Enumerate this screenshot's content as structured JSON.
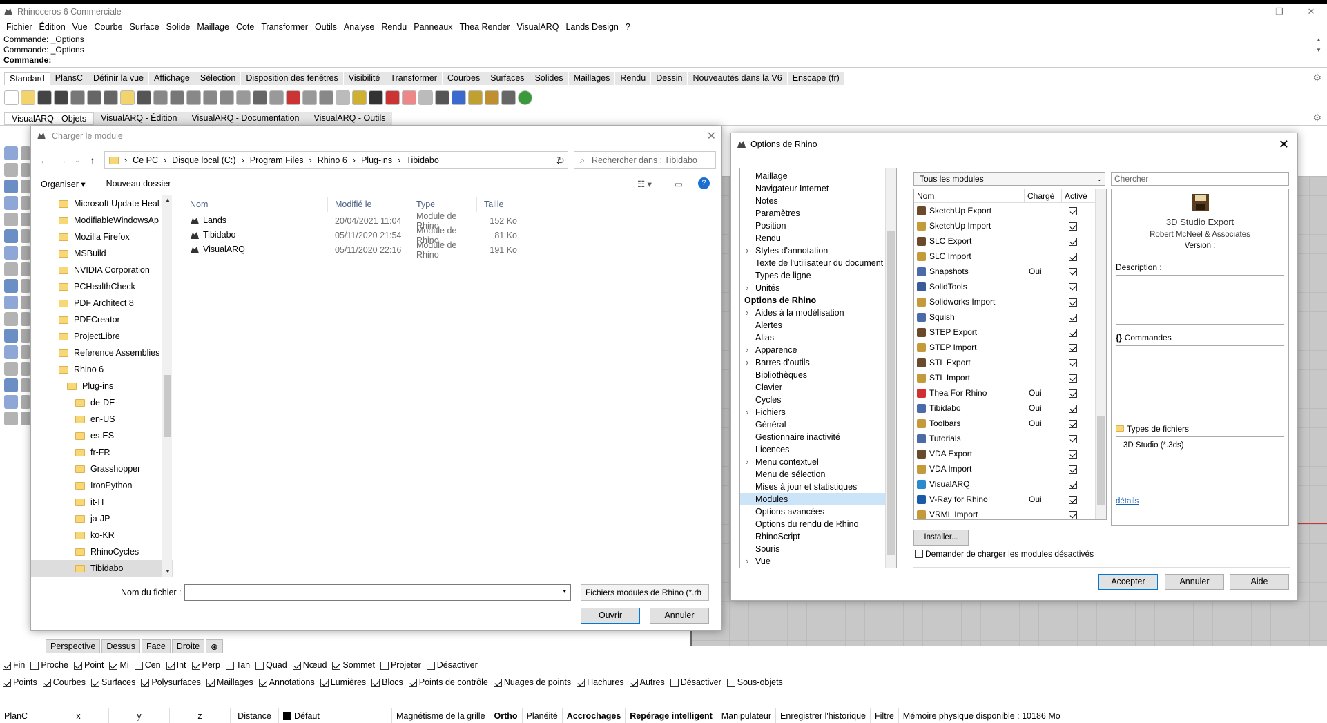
{
  "app": {
    "title": "Rhinoceros 6 Commerciale",
    "menu": [
      "Fichier",
      "Édition",
      "Vue",
      "Courbe",
      "Surface",
      "Solide",
      "Maillage",
      "Cote",
      "Transformer",
      "Outils",
      "Analyse",
      "Rendu",
      "Panneaux",
      "Thea Render",
      "VisualARQ",
      "Lands Design",
      "?"
    ],
    "command_lines": [
      "Commande: _Options",
      "Commande: _Options"
    ],
    "command_prompt": "Commande:",
    "toolbar_tabs": [
      "Standard",
      "PlansC",
      "Définir la vue",
      "Affichage",
      "Sélection",
      "Disposition des fenêtres",
      "Visibilité",
      "Transformer",
      "Courbes",
      "Surfaces",
      "Solides",
      "Maillages",
      "Rendu",
      "Dessin",
      "Nouveautés dans la V6",
      "Enscape (fr)"
    ],
    "visualarq_tabs": [
      "VisualARQ - Objets",
      "VisualARQ - Édition",
      "VisualARQ - Documentation",
      "VisualARQ - Outils"
    ],
    "viewport_tabs": [
      "Perspective",
      "Dessus",
      "Face",
      "Droite"
    ],
    "snap_row": [
      {
        "label": "Fin",
        "on": true
      },
      {
        "label": "Proche",
        "on": false
      },
      {
        "label": "Point",
        "on": true
      },
      {
        "label": "Mi",
        "on": true
      },
      {
        "label": "Cen",
        "on": false
      },
      {
        "label": "Int",
        "on": true
      },
      {
        "label": "Perp",
        "on": true
      },
      {
        "label": "Tan",
        "on": false
      },
      {
        "label": "Quad",
        "on": false
      },
      {
        "label": "Nœud",
        "on": true
      },
      {
        "label": "Sommet",
        "on": true
      },
      {
        "label": "Projeter",
        "on": false
      },
      {
        "label": "Désactiver",
        "on": false
      }
    ],
    "filter_row": [
      {
        "label": "Points",
        "on": true
      },
      {
        "label": "Courbes",
        "on": true
      },
      {
        "label": "Surfaces",
        "on": true
      },
      {
        "label": "Polysurfaces",
        "on": true
      },
      {
        "label": "Maillages",
        "on": true
      },
      {
        "label": "Annotations",
        "on": true
      },
      {
        "label": "Lumières",
        "on": true
      },
      {
        "label": "Blocs",
        "on": true
      },
      {
        "label": "Points de contrôle",
        "on": true
      },
      {
        "label": "Nuages de points",
        "on": true
      },
      {
        "label": "Hachures",
        "on": true
      },
      {
        "label": "Autres",
        "on": true
      },
      {
        "label": "Désactiver",
        "on": false
      },
      {
        "label": "Sous-objets",
        "on": false
      }
    ],
    "status": {
      "plane": "PlanC",
      "x": "x",
      "y": "y",
      "z": "z",
      "distance": "Distance",
      "layer": "Défaut",
      "grid_snap": "Magnétisme de la grille",
      "ortho": "Ortho",
      "planar": "Planéité",
      "osnap": "Accrochages",
      "smarttrack": "Repérage intelligent",
      "gumball": "Manipulateur",
      "history": "Enregistrer l'historique",
      "filter": "Filtre",
      "memory": "Mémoire physique disponible : 10186 Mo"
    }
  },
  "file_dialog": {
    "title": "Charger le module",
    "breadcrumb": [
      "Ce PC",
      "Disque local (C:)",
      "Program Files",
      "Rhino 6",
      "Plug-ins",
      "Tibidabo"
    ],
    "search_placeholder": "Rechercher dans : Tibidabo",
    "organize": "Organiser",
    "new_folder": "Nouveau dossier",
    "tree": [
      {
        "label": "Microsoft Update Heal",
        "indent": 0
      },
      {
        "label": "ModifiableWindowsAp",
        "indent": 0
      },
      {
        "label": "Mozilla Firefox",
        "indent": 0
      },
      {
        "label": "MSBuild",
        "indent": 0
      },
      {
        "label": "NVIDIA Corporation",
        "indent": 0
      },
      {
        "label": "PCHealthCheck",
        "indent": 0
      },
      {
        "label": "PDF Architect 8",
        "indent": 0
      },
      {
        "label": "PDFCreator",
        "indent": 0
      },
      {
        "label": "ProjectLibre",
        "indent": 0
      },
      {
        "label": "Reference Assemblies",
        "indent": 0
      },
      {
        "label": "Rhino 6",
        "indent": 0
      },
      {
        "label": "Plug-ins",
        "indent": 1
      },
      {
        "label": "de-DE",
        "indent": 2
      },
      {
        "label": "en-US",
        "indent": 2
      },
      {
        "label": "es-ES",
        "indent": 2
      },
      {
        "label": "fr-FR",
        "indent": 2
      },
      {
        "label": "Grasshopper",
        "indent": 2
      },
      {
        "label": "IronPython",
        "indent": 2
      },
      {
        "label": "it-IT",
        "indent": 2
      },
      {
        "label": "ja-JP",
        "indent": 2
      },
      {
        "label": "ko-KR",
        "indent": 2
      },
      {
        "label": "RhinoCycles",
        "indent": 2
      },
      {
        "label": "Tibidabo",
        "indent": 2,
        "selected": true
      }
    ],
    "columns": [
      "Nom",
      "Modifié le",
      "Type",
      "Taille"
    ],
    "files": [
      {
        "name": "Lands",
        "modified": "20/04/2021 11:04",
        "type": "Module de Rhino",
        "size": "152 Ko"
      },
      {
        "name": "Tibidabo",
        "modified": "05/11/2020 21:54",
        "type": "Module de Rhino",
        "size": "81 Ko"
      },
      {
        "name": "VisualARQ",
        "modified": "05/11/2020 22:16",
        "type": "Module de Rhino",
        "size": "191 Ko"
      }
    ],
    "filename_label": "Nom du fichier :",
    "filename_value": "",
    "filetype": "Fichiers modules de Rhino (*.rh",
    "open": "Ouvrir",
    "cancel": "Annuler"
  },
  "options_dialog": {
    "title": "Options de Rhino",
    "tree": [
      {
        "label": "Maillage",
        "bold": false,
        "expand": false
      },
      {
        "label": "Navigateur Internet",
        "bold": false,
        "expand": false
      },
      {
        "label": "Notes",
        "bold": false,
        "expand": false
      },
      {
        "label": "Paramètres",
        "bold": false,
        "expand": false
      },
      {
        "label": "Position",
        "bold": false,
        "expand": false
      },
      {
        "label": "Rendu",
        "bold": false,
        "expand": false
      },
      {
        "label": "Styles d'annotation",
        "bold": false,
        "expand": true
      },
      {
        "label": "Texte de l'utilisateur du document",
        "bold": false,
        "expand": false
      },
      {
        "label": "Types de ligne",
        "bold": false,
        "expand": false
      },
      {
        "label": "Unités",
        "bold": false,
        "expand": true
      },
      {
        "label": "Options de Rhino",
        "bold": true,
        "expand": false
      },
      {
        "label": "Aides à la modélisation",
        "bold": false,
        "expand": true
      },
      {
        "label": "Alertes",
        "bold": false,
        "expand": false
      },
      {
        "label": "Alias",
        "bold": false,
        "expand": false
      },
      {
        "label": "Apparence",
        "bold": false,
        "expand": true
      },
      {
        "label": "Barres d'outils",
        "bold": false,
        "expand": true
      },
      {
        "label": "Bibliothèques",
        "bold": false,
        "expand": false
      },
      {
        "label": "Clavier",
        "bold": false,
        "expand": false
      },
      {
        "label": "Cycles",
        "bold": false,
        "expand": false
      },
      {
        "label": "Fichiers",
        "bold": false,
        "expand": true
      },
      {
        "label": "Général",
        "bold": false,
        "expand": false
      },
      {
        "label": "Gestionnaire inactivité",
        "bold": false,
        "expand": false
      },
      {
        "label": "Licences",
        "bold": false,
        "expand": false
      },
      {
        "label": "Menu contextuel",
        "bold": false,
        "expand": true
      },
      {
        "label": "Menu de sélection",
        "bold": false,
        "expand": false
      },
      {
        "label": "Mises à jour et statistiques",
        "bold": false,
        "expand": false
      },
      {
        "label": "Modules",
        "bold": false,
        "expand": false,
        "selected": true
      },
      {
        "label": "Options avancées",
        "bold": false,
        "expand": false
      },
      {
        "label": "Options du rendu de Rhino",
        "bold": false,
        "expand": false
      },
      {
        "label": "RhinoScript",
        "bold": false,
        "expand": false
      },
      {
        "label": "Souris",
        "bold": false,
        "expand": false
      },
      {
        "label": "Vue",
        "bold": false,
        "expand": true
      }
    ],
    "filter": "Tous les modules",
    "search_placeholder": "Chercher",
    "columns": [
      "Nom",
      "Chargé",
      "Activé"
    ],
    "modules": [
      {
        "name": "SketchUp Export",
        "loaded": "",
        "enabled": true,
        "color": "#6b4a2b"
      },
      {
        "name": "SketchUp Import",
        "loaded": "",
        "enabled": true,
        "color": "#c49a3a"
      },
      {
        "name": "SLC Export",
        "loaded": "",
        "enabled": true,
        "color": "#6b4a2b"
      },
      {
        "name": "SLC Import",
        "loaded": "",
        "enabled": true,
        "color": "#c49a3a"
      },
      {
        "name": "Snapshots",
        "loaded": "Oui",
        "enabled": true,
        "color": "#4a6aa8"
      },
      {
        "name": "SolidTools",
        "loaded": "",
        "enabled": true,
        "color": "#3a5a9a"
      },
      {
        "name": "Solidworks Import",
        "loaded": "",
        "enabled": true,
        "color": "#c49a3a"
      },
      {
        "name": "Squish",
        "loaded": "",
        "enabled": true,
        "color": "#4a6aa8"
      },
      {
        "name": "STEP Export",
        "loaded": "",
        "enabled": true,
        "color": "#6b4a2b"
      },
      {
        "name": "STEP Import",
        "loaded": "",
        "enabled": true,
        "color": "#c49a3a"
      },
      {
        "name": "STL Export",
        "loaded": "",
        "enabled": true,
        "color": "#6b4a2b"
      },
      {
        "name": "STL Import",
        "loaded": "",
        "enabled": true,
        "color": "#c49a3a"
      },
      {
        "name": "Thea For Rhino",
        "loaded": "Oui",
        "enabled": true,
        "color": "#d03030"
      },
      {
        "name": "Tibidabo",
        "loaded": "Oui",
        "enabled": true,
        "color": "#4a6aa8"
      },
      {
        "name": "Toolbars",
        "loaded": "Oui",
        "enabled": true,
        "color": "#c49a3a"
      },
      {
        "name": "Tutorials",
        "loaded": "",
        "enabled": true,
        "color": "#4a6aa8"
      },
      {
        "name": "VDA Export",
        "loaded": "",
        "enabled": true,
        "color": "#6b4a2b"
      },
      {
        "name": "VDA Import",
        "loaded": "",
        "enabled": true,
        "color": "#c49a3a"
      },
      {
        "name": "VisualARQ",
        "loaded": "",
        "enabled": true,
        "color": "#2a8ad0"
      },
      {
        "name": "V-Ray for Rhino",
        "loaded": "Oui",
        "enabled": true,
        "color": "#1a5aa8"
      },
      {
        "name": "VRML Import",
        "loaded": "",
        "enabled": true,
        "color": "#c49a3a"
      }
    ],
    "detail": {
      "name": "3D Studio Export",
      "author": "Robert McNeel & Associates",
      "version_label": "Version :",
      "description_label": "Description :",
      "commands_label": "Commandes",
      "filetypes_label": "Types de fichiers",
      "filetypes_value": "3D Studio (*.3ds)",
      "details_link": "détails"
    },
    "install": "Installer...",
    "ask_load_label": "Demander de charger les modules désactivés",
    "ok": "Accepter",
    "cancel": "Annuler",
    "help": "Aide"
  }
}
